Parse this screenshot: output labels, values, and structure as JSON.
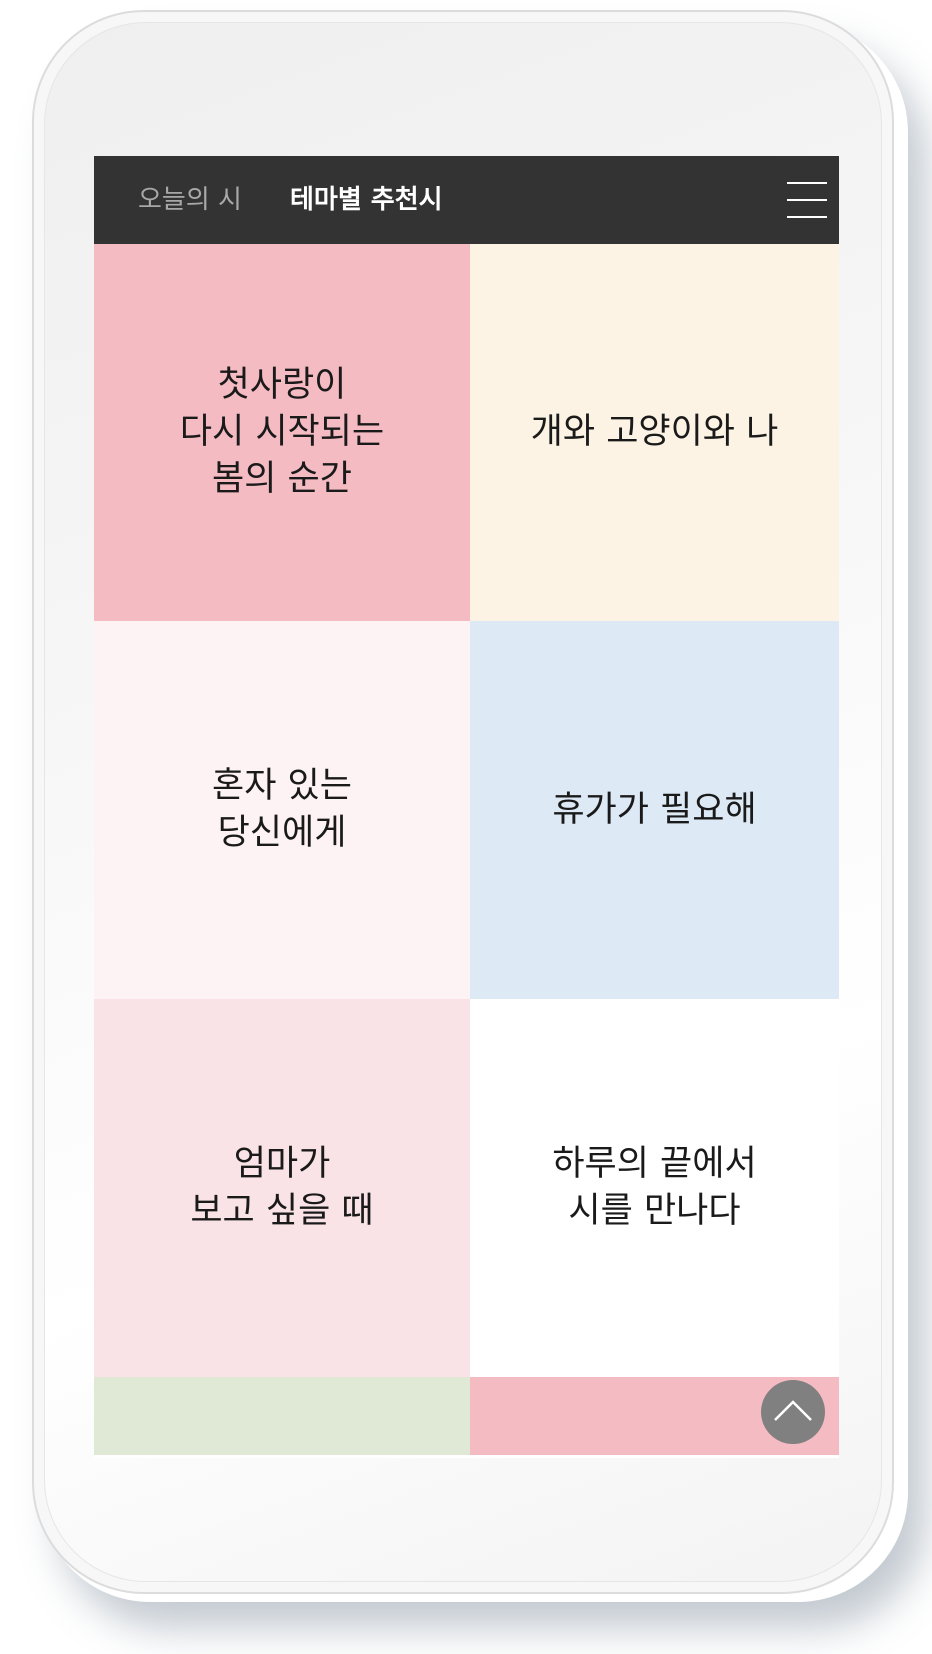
{
  "header": {
    "tabs": [
      {
        "label": "오늘의 시",
        "active": false
      },
      {
        "label": "테마별 추천시",
        "active": true
      }
    ],
    "menu_icon": "hamburger-menu-icon"
  },
  "themes": [
    {
      "label": "첫사랑이\n다시 시작되는\n봄의 순간",
      "color": "#f5bbc3"
    },
    {
      "label": "개와 고양이와 나",
      "color": "#fcf3e5"
    },
    {
      "label": "혼자 있는\n당신에게",
      "color": "#fdf3f5"
    },
    {
      "label": "휴가가 필요해",
      "color": "#dde9f4"
    },
    {
      "label": "엄마가\n보고 싶을 때",
      "color": "#f9e3e6"
    },
    {
      "label": "하루의 끝에서\n시를 만나다",
      "color": "#ffffff"
    },
    {
      "label": "",
      "color": "#e0e8d6"
    },
    {
      "label": "",
      "color": "#f5bbc3"
    }
  ],
  "scroll_top": {
    "icon": "chevron-up-icon",
    "color": "#808080"
  },
  "colors": {
    "navbar": "#333333",
    "tab_active": "#ffffff",
    "tab_inactive": "#a8a8a8"
  }
}
